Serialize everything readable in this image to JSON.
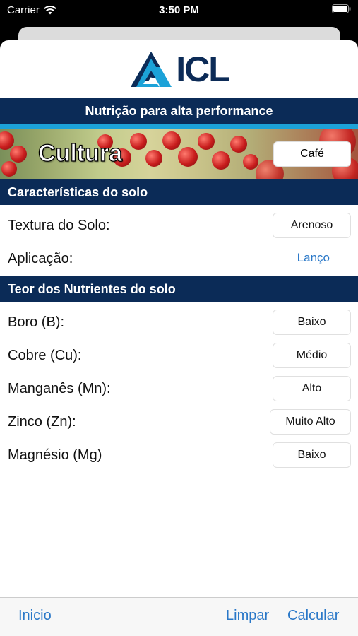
{
  "status": {
    "carrier": "Carrier",
    "time": "3:50 PM"
  },
  "logo": {
    "text": "ICL"
  },
  "tagline": "Nutrição para alta performance",
  "culture": {
    "label": "Cultura",
    "value": "Café"
  },
  "soil": {
    "title": "Características do solo",
    "texture": {
      "label": "Textura do Solo:",
      "value": "Arenoso"
    },
    "application": {
      "label": "Aplicação:",
      "value": "Lanço"
    }
  },
  "nutrients": {
    "title": "Teor dos Nutrientes do solo",
    "items": [
      {
        "label": "Boro (B):",
        "value": "Baixo"
      },
      {
        "label": "Cobre (Cu):",
        "value": "Médio"
      },
      {
        "label": "Manganês (Mn):",
        "value": "Alto"
      },
      {
        "label": "Zinco (Zn):",
        "value": "Muito Alto"
      },
      {
        "label": "Magnésio (Mg)",
        "value": "Baixo"
      }
    ]
  },
  "toolbar": {
    "home": "Inicio",
    "clear": "Limpar",
    "calculate": "Calcular"
  },
  "colors": {
    "navy": "#0b2b57",
    "accent": "#1ca2d8",
    "link": "#2a78c8"
  }
}
